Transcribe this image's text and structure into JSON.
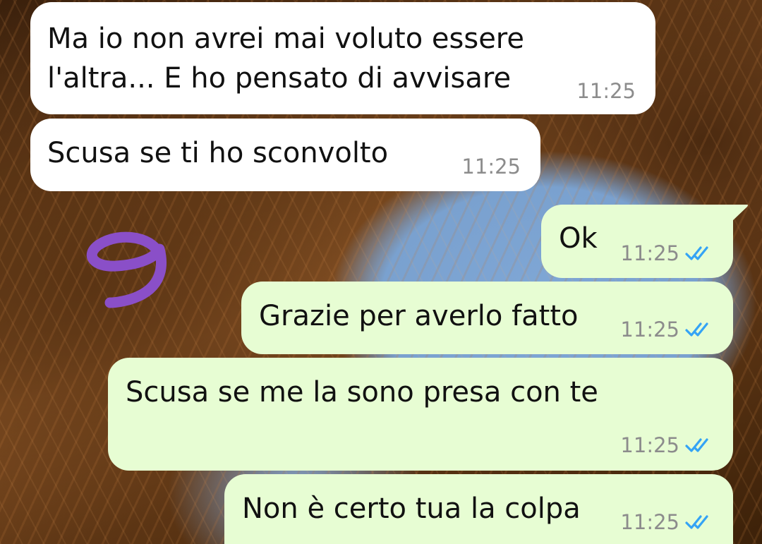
{
  "chat": {
    "messages": [
      {
        "direction": "incoming",
        "text": "Ma io non avrei mai voluto essere\nl'altra... E ho pensato di avvisare",
        "time": "11:25"
      },
      {
        "direction": "incoming",
        "text": "Scusa se ti ho sconvolto",
        "time": "11:25"
      },
      {
        "direction": "outgoing",
        "text": "Ok",
        "time": "11:25",
        "status": "read-double-check-icon"
      },
      {
        "direction": "outgoing",
        "text": "Grazie per averlo fatto",
        "time": "11:25",
        "status": "read-double-check-icon"
      },
      {
        "direction": "outgoing",
        "text": "Scusa se me la sono presa con te",
        "time": "11:25",
        "status": "read-double-check-icon"
      },
      {
        "direction": "outgoing",
        "text": "Non è certo tua la colpa",
        "time": "11:25",
        "status": "read-double-check-icon"
      }
    ],
    "overlay": {
      "handwritten_number": "9",
      "color": "#8a4fc8"
    }
  },
  "colors": {
    "incoming_bubble": "#ffffff",
    "outgoing_bubble": "#e7fdd3",
    "timestamp": "#8c8c8c",
    "read_ticks": "#34a3f5"
  }
}
